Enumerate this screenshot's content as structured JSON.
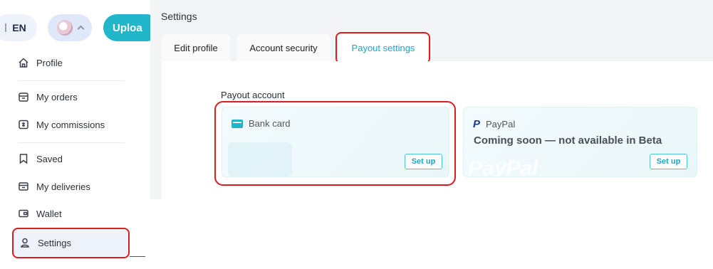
{
  "header": {
    "language": "EN",
    "upload_label": "Uploa"
  },
  "sidebar": {
    "items": [
      {
        "label": "Profile",
        "icon": "home-icon"
      },
      {
        "label": "My orders",
        "icon": "shop-icon"
      },
      {
        "label": "My commissions",
        "icon": "money-icon"
      },
      {
        "label": "Saved",
        "icon": "bookmark-icon"
      },
      {
        "label": "My deliveries",
        "icon": "box-icon"
      },
      {
        "label": "Wallet",
        "icon": "wallet-icon"
      },
      {
        "label": "Settings",
        "icon": "user-icon"
      }
    ],
    "active": "Settings"
  },
  "main": {
    "title": "Settings",
    "tabs": [
      {
        "label": "Edit profile"
      },
      {
        "label": "Account security"
      },
      {
        "label": "Payout settings"
      }
    ],
    "active_tab": "Payout settings",
    "payout_label": "Payout account",
    "cards": {
      "bank": {
        "title": "Bank card",
        "button": "Set up"
      },
      "paypal": {
        "title": "PayPal",
        "status": "Coming soon — not available in Beta",
        "button": "Set up",
        "watermark": "PayPal"
      }
    }
  },
  "colors": {
    "accent": "#1ea7c6",
    "upload_bg": "#21b6c9",
    "highlight": "#d91e1e"
  }
}
